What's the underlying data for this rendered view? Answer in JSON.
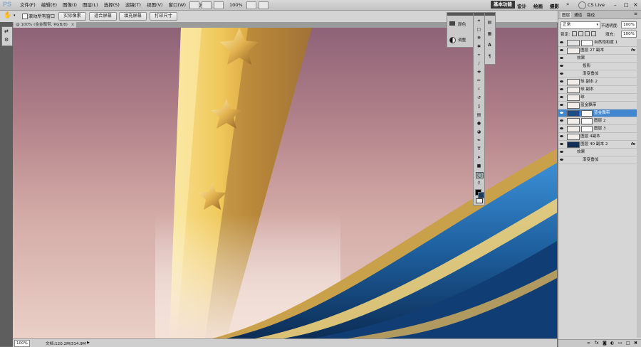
{
  "app": {
    "logo": "PS",
    "menus": [
      "文件(F)",
      "编辑(E)",
      "图像(I)",
      "图层(L)",
      "选择(S)",
      "滤镜(T)",
      "视图(V)",
      "窗口(W)",
      "帮助(H)"
    ],
    "zoom": "100%",
    "workspaces": [
      "基本功能",
      "设计",
      "绘画",
      "摄影"
    ],
    "workspace_more": "»",
    "cs_live": "CS Live"
  },
  "options": {
    "scroll_all": "滚动所有窗口",
    "buttons": [
      "实际像素",
      "适合屏幕",
      "填充屏幕",
      "打印尺寸"
    ]
  },
  "document": {
    "tab": "@ 100% (金金飘带, RGB/8)",
    "zoom": "100%",
    "doc_info": "文档:120.2M/314.9M"
  },
  "small_panel": {
    "items": [
      "颜色",
      "调整"
    ]
  },
  "layers_panel": {
    "tabs": [
      "图层",
      "通道",
      "路径"
    ],
    "blend_mode": "正常",
    "opacity_label": "不透明度:",
    "opacity_value": "100%",
    "lock_label": "锁定:",
    "fill_label": "填充:",
    "fill_value": "100%",
    "layers": [
      {
        "name": "自然饱和度 1",
        "type": "adjust",
        "fx": ""
      },
      {
        "name": "图层 27 副本",
        "type": "layer",
        "fx": "fx"
      },
      {
        "name": "效果",
        "type": "effect",
        "fx": ""
      },
      {
        "name": "投影",
        "type": "effect2",
        "fx": ""
      },
      {
        "name": "渐变叠加",
        "type": "effect2",
        "fx": ""
      },
      {
        "name": "球 副本 2",
        "type": "layer",
        "fx": ""
      },
      {
        "name": "球 副本",
        "type": "layer",
        "fx": ""
      },
      {
        "name": "球",
        "type": "layer",
        "fx": ""
      },
      {
        "name": "蓝金飘带",
        "type": "layer",
        "fx": ""
      },
      {
        "name": "蓝金飘带",
        "type": "selected",
        "fx": ""
      },
      {
        "name": "图层 2",
        "type": "masked",
        "fx": ""
      },
      {
        "name": "图层 3",
        "type": "masked",
        "fx": ""
      },
      {
        "name": "图层 4副本",
        "type": "layer",
        "fx": ""
      },
      {
        "name": "图层 40 副本 2",
        "type": "dark",
        "fx": "fx"
      },
      {
        "name": "效果",
        "type": "effect",
        "fx": ""
      },
      {
        "name": "渐变叠加",
        "type": "effect2",
        "fx": ""
      }
    ],
    "footer_icons": [
      "link-icon",
      "fx-icon",
      "mask-icon",
      "adjustment-icon",
      "group-icon",
      "new-layer-icon",
      "trash-icon"
    ]
  },
  "colors": {
    "accent_selected": "#3f86cf",
    "gold": "#e8c160",
    "ribbon_blue": "#1e5f9e",
    "canvas_top": "#8e6277",
    "canvas_bottom": "#ead0c7"
  }
}
